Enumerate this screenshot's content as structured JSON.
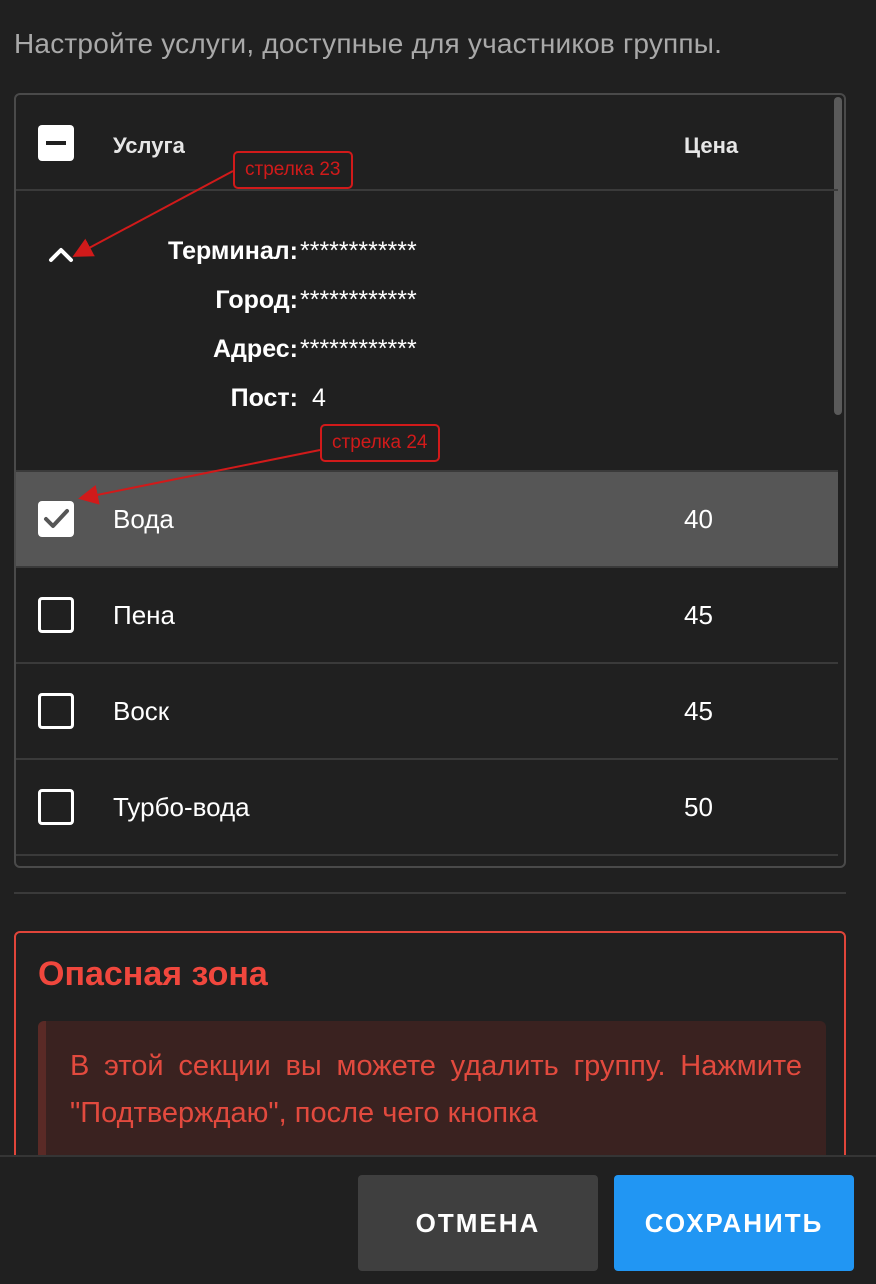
{
  "subtitle": "Настройте услуги, доступные для участников группы.",
  "table": {
    "header_checkbox_state": "indeterminate",
    "col_service": "Услуга",
    "col_price": "Цена"
  },
  "info": {
    "terminal_label": "Терминал:",
    "terminal_value": "************",
    "city_label": "Город:",
    "city_value": "************",
    "address_label": "Адрес:",
    "address_value": "************",
    "post_label": "Пост:",
    "post_value": "4"
  },
  "services": [
    {
      "name": "Вода",
      "price": "40",
      "checked": true
    },
    {
      "name": "Пена",
      "price": "45",
      "checked": false
    },
    {
      "name": "Воск",
      "price": "45",
      "checked": false
    },
    {
      "name": "Турбо-вода",
      "price": "50",
      "checked": false
    }
  ],
  "danger": {
    "title": "Опасная зона",
    "text": "В этой секции вы можете удалить группу. Нажмите \"Подтверждаю\", после чего кнопка"
  },
  "footer": {
    "cancel": "ОТМЕНА",
    "save": "СОХРАНИТЬ"
  },
  "annotations": {
    "arrow23": "стрелка 23",
    "arrow24": "стрелка 24"
  },
  "colors": {
    "background": "#202020",
    "selected_row": "#565656",
    "accent_blue": "#2196f3",
    "danger_red": "#f0473d"
  }
}
